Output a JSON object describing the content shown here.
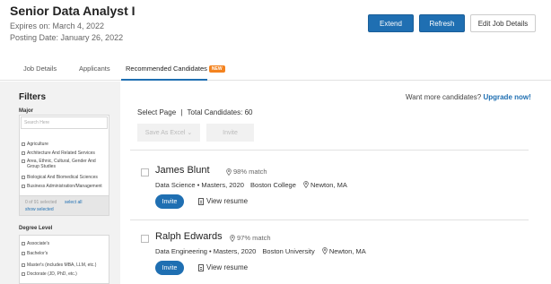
{
  "job": {
    "title": "Senior Data Analyst I",
    "expires": "Expires on: March 4, 2022",
    "posted": "Posting Date: January 26, 2022"
  },
  "header_buttons": {
    "extend": "Extend",
    "refresh": "Refresh",
    "edit": "Edit Job Details"
  },
  "tabs": [
    {
      "label": "Job Details"
    },
    {
      "label": "Applicants"
    },
    {
      "label": "Recommended Candidates",
      "badge": "NEW"
    }
  ],
  "filters": {
    "title": "Filters",
    "major": {
      "label": "Major",
      "search_placeholder": "Search Here",
      "options": [
        "Agriculture",
        "Architecture And Related Services",
        "Area, Ethnic, Cultural, Gender And Group Studies",
        "Biological And Biomedical Sciences",
        "Business Administration/Management"
      ],
      "selected_count": "0 of 91 selected",
      "select_all": "select all",
      "show_selected": "show selected"
    },
    "degree": {
      "label": "Degree Level",
      "options": [
        "Associate's",
        "Bachelor's",
        "Master's (includes MBA, LLM, etc.)",
        "Doctorate (JD, PhD, etc.)"
      ]
    }
  },
  "upgrade": {
    "text": "Want more candidates?",
    "link": "Upgrade now!"
  },
  "results": {
    "select_page": "Select Page",
    "separator": "|",
    "total": "Total Candidates: 60",
    "save_excel": "Save As Excel",
    "invite_all": "Invite"
  },
  "candidates": [
    {
      "name": "James Blunt",
      "match": "98% match",
      "field": "Data Science",
      "degree": "Masters, 2020",
      "school": "Boston College",
      "location": "Newton, MA",
      "invite": "Invite",
      "resume": "View resume"
    },
    {
      "name": "Ralph Edwards",
      "match": "97% match",
      "field": "Data Engineering",
      "degree": "Masters, 2020",
      "school": "Boston University",
      "location": "Newton, MA",
      "invite": "Invite",
      "resume": "View resume"
    }
  ],
  "colors": {
    "primary": "#1f6fb2",
    "badge": "#f4831f",
    "sidebar_bg": "#f2f2f2"
  }
}
